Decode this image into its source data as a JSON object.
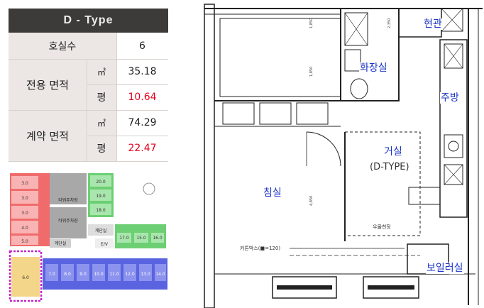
{
  "spec": {
    "title": "D - Type",
    "rows": {
      "units_label": "호실수",
      "units_value": "6",
      "exclusive_label": "전용 면적",
      "exclusive_m2_unit": "㎡",
      "exclusive_m2_value": "35.18",
      "exclusive_py_unit": "평",
      "exclusive_py_value": "10.64",
      "contract_label": "계약 면적",
      "contract_m2_unit": "㎡",
      "contract_m2_value": "74.29",
      "contract_py_unit": "평",
      "contract_py_value": "22.47"
    }
  },
  "site_plan": {
    "labels": {
      "tower_parking_1": "타워주차장",
      "tower_parking_2": "타워주차장",
      "stairs_1": "계단실",
      "stairs_2": "계단실",
      "ev": "E/V"
    },
    "unit_numbers_red": [
      "3.0",
      "3.0",
      "3.0",
      "4.0",
      "5.0"
    ],
    "unit_numbers_green": [
      "20.0",
      "19.0",
      "18.0",
      "15.0",
      "16.0",
      "17.0"
    ],
    "unit_numbers_blue": [
      "7.0",
      "8.0",
      "9.0",
      "10.0",
      "11.0",
      "12.0",
      "13.0",
      "14.0"
    ],
    "highlight_unit_number": "6.0",
    "colors": {
      "red": "#f06b6b",
      "gray": "#a8a8a8",
      "green": "#6ccf73",
      "blue": "#5a63e0",
      "yellow": "#f4d68a",
      "highlight_border": "#c524c9"
    }
  },
  "floor_plan": {
    "rooms": {
      "entrance": "현관",
      "bathroom": "화장실",
      "kitchen": "주방",
      "living": "거실",
      "bedroom": "침실",
      "boiler": "보일러실"
    },
    "living_type": "(D-TYPE)",
    "annotations": {
      "ceiling": "우물천정",
      "curtain_box": "커튼박스(■=120)"
    },
    "dims": [
      "1,850",
      "1,850",
      "4,850",
      "2,350"
    ]
  }
}
